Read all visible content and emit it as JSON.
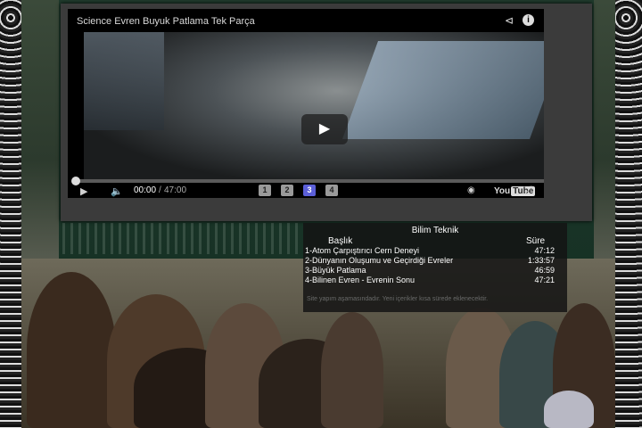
{
  "player": {
    "title": "Science Evren Buyuk Patlama Tek Parça",
    "time_current": "00:00",
    "time_separator": "/",
    "time_total": "47:00",
    "parts": [
      "1",
      "2",
      "3",
      "4"
    ],
    "active_part": "3",
    "logo_text": "You",
    "logo_tube": "Tube",
    "progress_fraction": 0
  },
  "playlist": {
    "title": "Bilim Teknik",
    "col_title": "Başlık",
    "col_duration": "Süre",
    "items": [
      {
        "title": "1-Atom Çarpıştırıcı Cern Deneyi",
        "duration": "47:12"
      },
      {
        "title": "2-Dünyanın Oluşumu ve Geçirdiği Evreler",
        "duration": "1:33:57"
      },
      {
        "title": "3-Büyük Patlama",
        "duration": "46:59"
      },
      {
        "title": "4-Bilinen Evren - Evrenin Sonu",
        "duration": "47:21"
      }
    ],
    "note": "Site yapım aşamasındadır. Yeni içerikler kısa sürede eklenecektir."
  },
  "colors": {
    "active_part": "#5b5fd8",
    "panel": "#3b3b3b"
  }
}
